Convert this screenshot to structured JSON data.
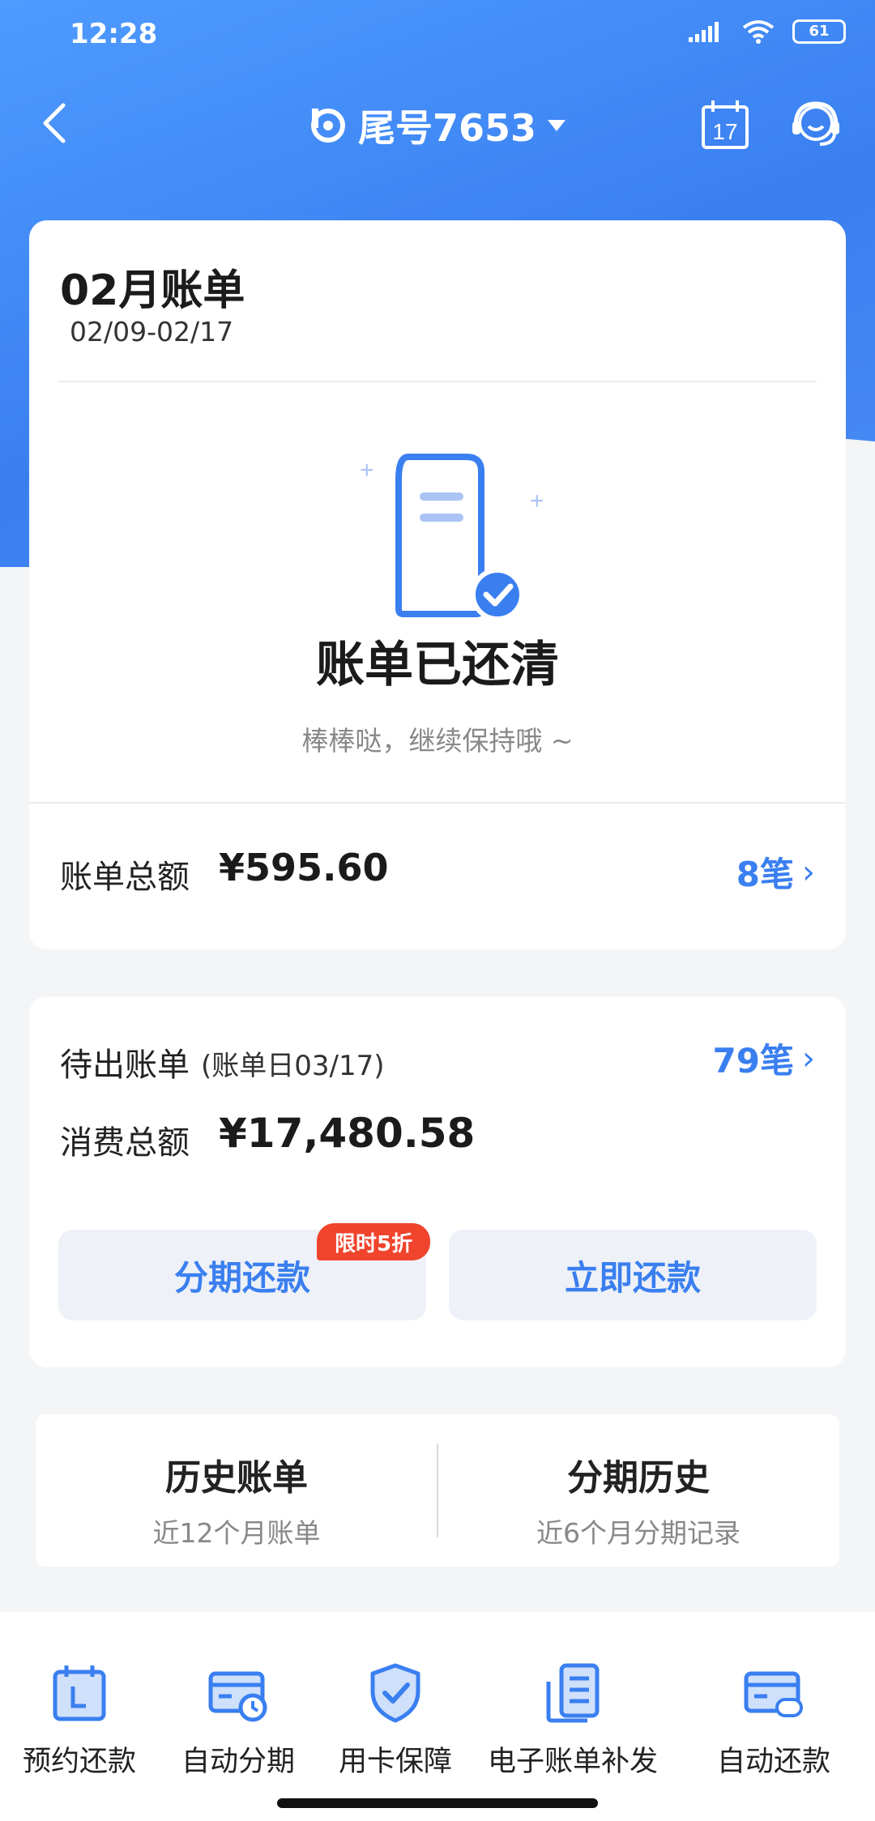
{
  "statusbar": {
    "time": "12:28",
    "battery": "61"
  },
  "header": {
    "title": "尾号7653",
    "calendar_day": "17"
  },
  "bill": {
    "title": "02月账单",
    "range": "02/09-02/17",
    "status_title": "账单已还清",
    "status_sub": "棒棒哒，继续保持哦 ~",
    "total_label": "账单总额",
    "total_amount": "¥595.60",
    "count": "8笔"
  },
  "pending": {
    "label": "待出账单",
    "note": "(账单日03/17)",
    "count": "79笔",
    "consume_label": "消费总额",
    "consume_amount": "¥17,480.58",
    "installment_button": "分期还款",
    "promo_badge": "限时5折",
    "repay_button": "立即还款"
  },
  "history": {
    "left_title": "历史账单",
    "left_sub": "近12个月账单",
    "right_title": "分期历史",
    "right_sub": "近6个月分期记录"
  },
  "tools": [
    {
      "label": "预约还款",
      "icon": "calendar-icon"
    },
    {
      "label": "自动分期",
      "icon": "card-clock-icon"
    },
    {
      "label": "用卡保障",
      "icon": "shield-check-icon"
    },
    {
      "label": "电子账单补发",
      "icon": "e-bill-icon"
    },
    {
      "label": "自动还款",
      "icon": "card-repeat-icon"
    }
  ],
  "colors": {
    "accent": "#3a7ff0",
    "promo": "#f0442d",
    "header_bg": "#4e9bff"
  }
}
